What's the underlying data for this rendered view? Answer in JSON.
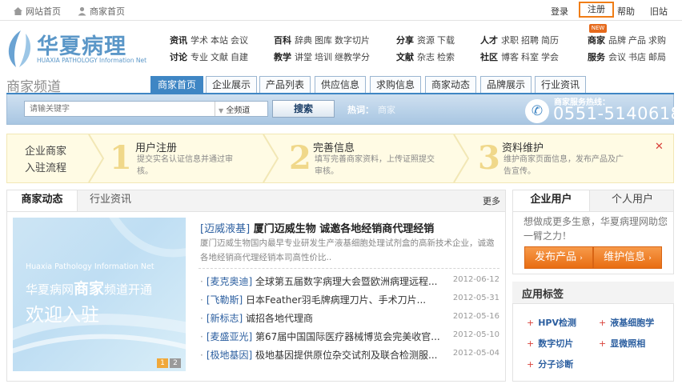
{
  "topbar": {
    "site_home": "网站首页",
    "merchant_home": "商家首页",
    "login": "登录",
    "register": "注册",
    "help": "帮助",
    "old_site": "旧站"
  },
  "logo": {
    "cn": "华夏病理",
    "en": "HUAXIA PATHOLOGY Information Net"
  },
  "nav": {
    "c1": {
      "r1": [
        "资讯",
        "学术",
        "本站",
        "会议"
      ],
      "r2": [
        "讨论",
        "专业",
        "文献",
        "自建"
      ]
    },
    "c2": {
      "r1": [
        "百科",
        "辞典",
        "图库",
        "数字切片"
      ],
      "r2": [
        "教学",
        "讲堂",
        "培训",
        "继教学分"
      ]
    },
    "c3": {
      "r1": [
        "分享",
        "资源",
        "下载"
      ],
      "r2": [
        "文献",
        "杂志",
        "检索"
      ]
    },
    "c4": {
      "r1": [
        "人才",
        "求职",
        "招聘",
        "简历"
      ],
      "r2": [
        "社区",
        "博客",
        "科室",
        "学会"
      ]
    },
    "c5": {
      "r1": [
        "商家",
        "品牌",
        "产品",
        "求购"
      ],
      "r2": [
        "服务",
        "会议",
        "书店",
        "邮局"
      ]
    },
    "new_badge": "NEW"
  },
  "channel": {
    "title": "商家频道",
    "tabs": [
      "商家首页",
      "企业展示",
      "产品列表",
      "供应信息",
      "求购信息",
      "商家动态",
      "品牌展示",
      "行业资讯"
    ]
  },
  "search": {
    "placeholder": "请输关键字",
    "scope": "全频道",
    "button": "搜索",
    "hot_label": "热词：",
    "hot_value": "商家",
    "hotline_label": "商家服务热线：",
    "hotline_number": "0551-5140618"
  },
  "process": {
    "title_l1": "企业商家",
    "title_l2": "入驻流程",
    "steps": [
      {
        "num": "1",
        "title": "用户注册",
        "desc": "提交实名认证信息并通过审核。"
      },
      {
        "num": "2",
        "title": "完善信息",
        "desc": "填写完善商家资料，上传证照提交审核。"
      },
      {
        "num": "3",
        "title": "资料维护",
        "desc": "维护商家页面信息，发布产品及广告宣传。"
      }
    ],
    "close": "✕"
  },
  "news": {
    "tabs": [
      "商家动态",
      "行业资讯"
    ],
    "more": "更多",
    "banner": {
      "en": "Huaxia Pathology Information Net",
      "cn1_a": "华夏病网",
      "cn1_b": "商家",
      "cn1_c": "频道开通",
      "cn2": "欢迎入驻",
      "pages": [
        "1",
        "2"
      ]
    },
    "headline": {
      "tag": "[迈威液基]",
      "title": "厦门迈威生物  诚邀各地经销商代理经销"
    },
    "summary": "厦门迈威生物国内最早专业研发生产液基细胞处理试剂盒的高新技术企业，诚邀各地经销商代理经销本司高性价比..",
    "items": [
      {
        "tag": "[麦克奥迪]",
        "title": "全球第五届数字病理大会暨欧洲病理远程...",
        "date": "2012-06-12"
      },
      {
        "tag": "[飞勒斯]",
        "title": "日本Feather羽毛牌病理刀片、手术刀片...",
        "date": "2012-05-31"
      },
      {
        "tag": "[新标志]",
        "title": "诚招各地代理商",
        "date": "2012-05-16"
      },
      {
        "tag": "[麦盛亚光]",
        "title": "第67届中国国际医疗器械博览会完美收官...",
        "date": "2012-05-10"
      },
      {
        "tag": "[极地基因]",
        "title": "极地基因提供原位杂交试剂及联合检测服...",
        "date": "2012-05-04"
      }
    ]
  },
  "user": {
    "tabs": [
      "企业用户",
      "个人用户"
    ],
    "promo": "想做成更多生意，华夏病理网助您一臂之力！",
    "btn_publish": "发布产品",
    "btn_maintain": "维护信息"
  },
  "tags": {
    "title": "应用标签",
    "items": [
      "HPV检测",
      "液基细胞学",
      "数字切片",
      "显微照相",
      "分子诊断"
    ]
  },
  "colors": {
    "accent": "#3f86c4",
    "orange": "#f07d16",
    "link": "#2c5fa0"
  }
}
